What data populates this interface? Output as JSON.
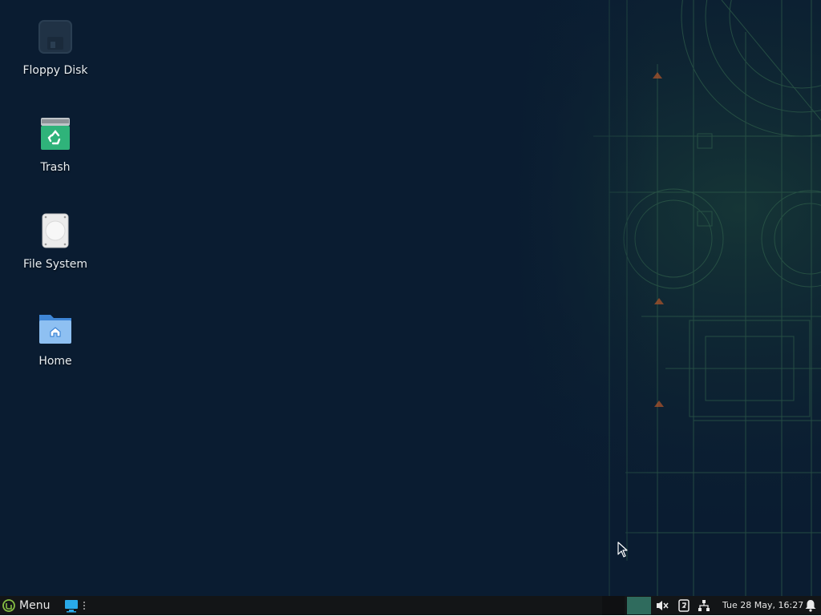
{
  "desktop": {
    "icons": [
      {
        "label": "Floppy Disk",
        "icon": "floppy-disk-icon"
      },
      {
        "label": "Trash",
        "icon": "trash-icon"
      },
      {
        "label": "File System",
        "icon": "hard-drive-icon"
      },
      {
        "label": "Home",
        "icon": "home-folder-icon"
      }
    ],
    "background_color": "#0a1c31",
    "accent_color": "#3c7a56"
  },
  "taskbar": {
    "menu_label": "Menu",
    "clock": "Tue 28 May, 16:27",
    "workspace_color": "#2f6b5d",
    "tray_icons": [
      "volume-muted-icon",
      "update-manager-icon",
      "network-icon",
      "notifications-bell-icon"
    ]
  }
}
